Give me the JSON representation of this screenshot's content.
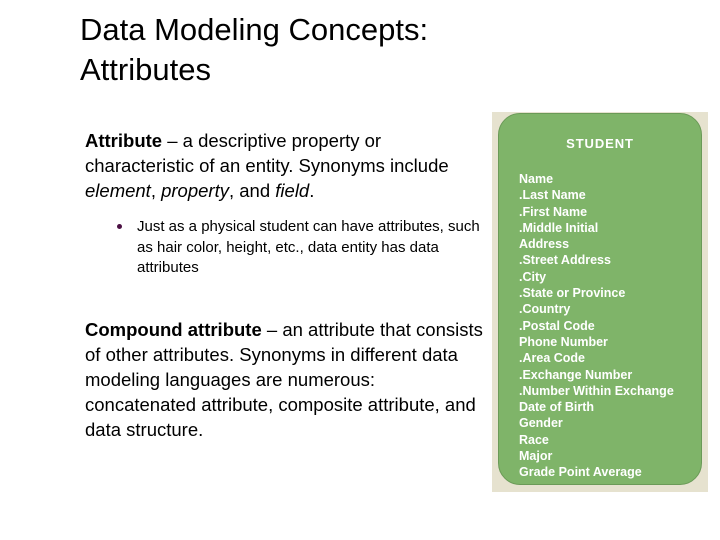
{
  "slide": {
    "title_lines": [
      "Data Modeling Concepts:",
      "Attributes"
    ],
    "background_color": "#ffffff"
  },
  "body": {
    "paragraph_1": {
      "lead": "Attribute",
      "rest_a": " – a descriptive property or characteristic of an entity. Synonyms include ",
      "em_1": "element",
      "sep_1": ", ",
      "em_2": "property",
      "sep_2": ", and ",
      "em_3": "field",
      "rest_b": "."
    },
    "bullets": [
      "Just as a physical student can have attributes, such as hair color, height, etc., data entity has data attributes"
    ],
    "bullet_color": "#4b1043",
    "paragraph_2": {
      "lead": "Compound attribute",
      "rest": " – an attribute that consists of other attributes. Synonyms in different data modeling languages are numerous: concatenated attribute, composite attribute, and data structure."
    }
  },
  "entity": {
    "title": "STUDENT",
    "fill_color": "#7fb469",
    "text_color": "#ffffff",
    "shadow_color": "#e6e2cf",
    "attributes": [
      "Name",
      ".Last Name",
      ".First Name",
      ".Middle Initial",
      "Address",
      ".Street Address",
      ".City",
      ".State or Province",
      ".Country",
      ".Postal Code",
      "Phone Number",
      ".Area Code",
      ".Exchange Number",
      ".Number Within Exchange",
      "Date of Birth",
      "Gender",
      "Race",
      "Major",
      "Grade Point Average"
    ]
  }
}
